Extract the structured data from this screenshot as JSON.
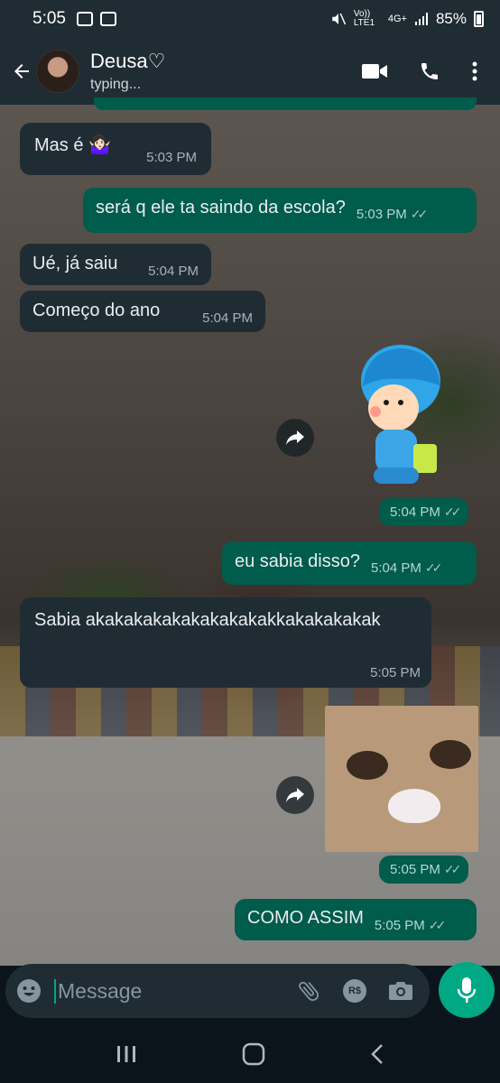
{
  "status_bar": {
    "time": "5:05",
    "network": "Vo)) LTE1",
    "signal": "4G+",
    "battery": "85%"
  },
  "header": {
    "contact_name": "Deusa♡",
    "contact_status": "typing..."
  },
  "messages": [
    {
      "dir": "in",
      "text": "Mas é 🤷🏻‍♀️",
      "time": "5:03 PM"
    },
    {
      "dir": "out",
      "text": "será q ele ta saindo da escola?",
      "time": "5:03 PM",
      "ticks": "✓✓"
    },
    {
      "dir": "in",
      "text": "Ué, já saiu",
      "time": "5:04 PM"
    },
    {
      "dir": "in",
      "text": "Começo do ano",
      "time": "5:04 PM"
    },
    {
      "dir": "out",
      "type": "sticker",
      "description": "",
      "time": "5:04 PM",
      "ticks": "✓✓"
    },
    {
      "dir": "out",
      "text": "eu sabia disso?",
      "time": "5:04 PM",
      "ticks": "✓✓"
    },
    {
      "dir": "in",
      "text": "Sabia akakakakakakakakakakkakakakakak",
      "time": "5:05 PM"
    },
    {
      "dir": "out",
      "type": "image",
      "time": "5:05 PM",
      "ticks": "✓✓"
    },
    {
      "dir": "out",
      "text": "COMO ASSIM",
      "time": "5:05 PM",
      "ticks": "✓✓"
    }
  ],
  "input": {
    "placeholder": "Message"
  },
  "icons": {
    "back": "arrow-left-icon",
    "video": "video-call-icon",
    "call": "phone-icon",
    "menu": "more-vert-icon",
    "emoji": "emoji-icon",
    "attach": "paperclip-icon",
    "payment": "R$",
    "camera": "camera-icon",
    "mic": "mic-icon",
    "forward": "forward-icon"
  },
  "colors": {
    "header_bg": "#1f2c33",
    "incoming_bubble": "#1f2c33",
    "outgoing_bubble": "#005c4b",
    "accent": "#00a884"
  }
}
